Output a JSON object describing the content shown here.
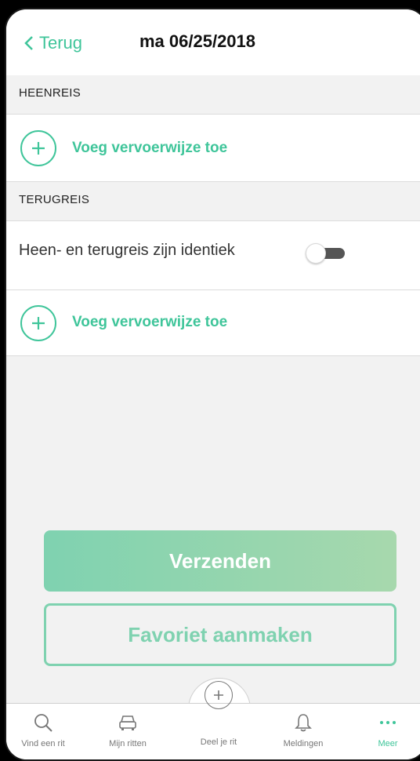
{
  "navbar": {
    "back_label": "Terug",
    "title": "ma 06/25/2018"
  },
  "sections": {
    "outbound_header": "HEENREIS",
    "outbound_add_label": "Voeg vervoerwijze toe",
    "return_header": "TERUGREIS",
    "identical_label": "Heen- en terugreis zijn identiek",
    "identical_toggle_on": false,
    "return_add_label": "Voeg vervoerwijze toe"
  },
  "buttons": {
    "submit_label": "Verzenden",
    "favorite_label": "Favoriet aanmaken"
  },
  "tabbar": {
    "items": [
      {
        "label": "Vind een rit",
        "icon": "search-icon"
      },
      {
        "label": "Mijn ritten",
        "icon": "car-icon"
      },
      {
        "label": "Deel je rit",
        "icon": "plus-circle-icon"
      },
      {
        "label": "Meldingen",
        "icon": "bell-icon"
      },
      {
        "label": "Meer",
        "icon": "more-dots-icon",
        "active": true
      }
    ]
  },
  "colors": {
    "accent": "#3fc59a",
    "button_gradient_start": "#7fd2b0",
    "button_gradient_end": "#a7d8ad",
    "background": "#f2f2f2"
  }
}
